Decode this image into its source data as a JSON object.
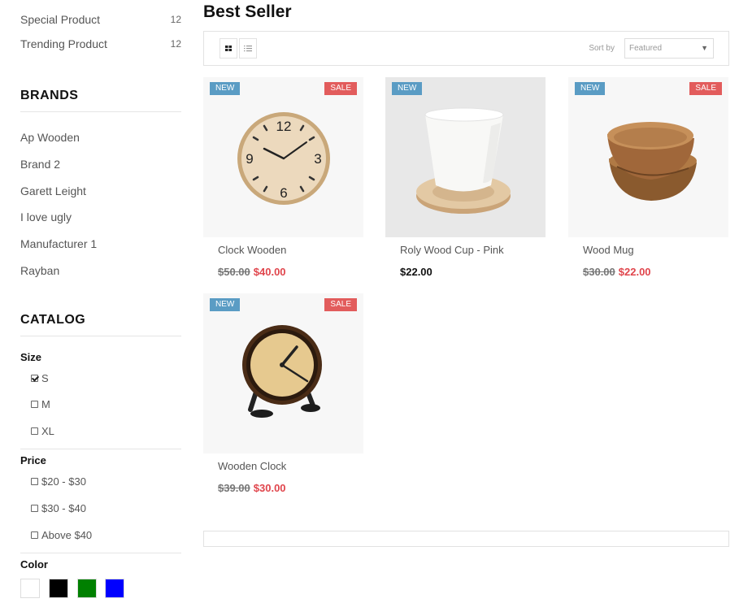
{
  "sidebar": {
    "top_links": [
      {
        "label": "Special Product",
        "count": "12"
      },
      {
        "label": "Trending Product",
        "count": "12"
      }
    ],
    "brands": {
      "title": "BRANDS",
      "items": [
        "Ap Wooden",
        "Brand 2",
        "Garett Leight",
        "I love ugly",
        "Manufacturer 1",
        "Rayban"
      ]
    },
    "catalog": {
      "title": "CATALOG",
      "size": {
        "label": "Size",
        "options": [
          {
            "label": "S",
            "checked": true
          },
          {
            "label": "M",
            "checked": false
          },
          {
            "label": "XL",
            "checked": false
          }
        ]
      },
      "price": {
        "label": "Price",
        "options": [
          {
            "label": "$20 - $30",
            "checked": false
          },
          {
            "label": "$30 - $40",
            "checked": false
          },
          {
            "label": "Above $40",
            "checked": false
          }
        ]
      },
      "color": {
        "label": "Color",
        "swatches": [
          "#ffffff",
          "#000000",
          "#008000",
          "#0000ff"
        ]
      }
    }
  },
  "main": {
    "title": "Best Seller",
    "toolbar": {
      "sort_label": "Sort by",
      "sort_value": "Featured",
      "grid_icon": "grid-view-icon",
      "list_icon": "list-view-icon"
    },
    "badges": {
      "new": "NEW",
      "sale": "SALE"
    },
    "products": [
      {
        "name": "Clock Wooden",
        "old_price": "$50.00",
        "price": "$40.00",
        "is_new": true,
        "on_sale": true
      },
      {
        "name": "Roly Wood Cup - Pink",
        "old_price": "",
        "price": "$22.00",
        "is_new": true,
        "on_sale": false
      },
      {
        "name": "Wood Mug",
        "old_price": "$30.00",
        "price": "$22.00",
        "is_new": true,
        "on_sale": true
      },
      {
        "name": "Wooden Clock",
        "old_price": "$39.00",
        "price": "$30.00",
        "is_new": true,
        "on_sale": true
      }
    ]
  }
}
